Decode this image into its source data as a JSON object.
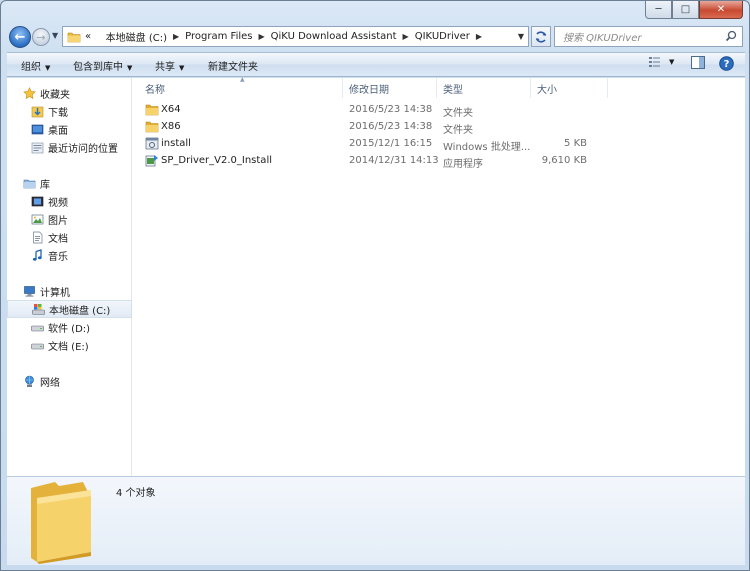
{
  "window": {
    "caption": {
      "minimize": "─",
      "maximize": "□",
      "close": "✕"
    }
  },
  "nav": {
    "back": "←",
    "forward": "→",
    "address_prefix": "«",
    "breadcrumbs": [
      "本地磁盘 (C:)",
      "Program Files",
      "QiKU Download Assistant",
      "QIKUDriver"
    ],
    "search_placeholder": "搜索 QIKUDriver"
  },
  "toolbar": {
    "organize": "组织",
    "include_library": "包含到库中",
    "share": "共享",
    "new_folder": "新建文件夹"
  },
  "sidebar": {
    "favorites": {
      "label": "收藏夹",
      "items": [
        "下载",
        "桌面",
        "最近访问的位置"
      ]
    },
    "libraries": {
      "label": "库",
      "items": [
        "视频",
        "图片",
        "文档",
        "音乐"
      ]
    },
    "computer": {
      "label": "计算机",
      "items": [
        "本地磁盘 (C:)",
        "软件 (D:)",
        "文档 (E:)"
      ]
    },
    "network": {
      "label": "网络"
    }
  },
  "columns": {
    "name": "名称",
    "modified": "修改日期",
    "type": "类型",
    "size": "大小"
  },
  "files": [
    {
      "name": "X64",
      "modified": "2016/5/23 14:38",
      "type": "文件夹",
      "size": "",
      "icon": "folder-icon"
    },
    {
      "name": "X86",
      "modified": "2016/5/23 14:38",
      "type": "文件夹",
      "size": "",
      "icon": "folder-icon"
    },
    {
      "name": "install",
      "modified": "2015/12/1 16:15",
      "type": "Windows 批处理...",
      "size": "5 KB",
      "icon": "batch-file-icon"
    },
    {
      "name": "SP_Driver_V2.0_Install",
      "modified": "2014/12/31 14:13",
      "type": "应用程序",
      "size": "9,610 KB",
      "icon": "application-icon"
    }
  ],
  "details": {
    "count": "4 个对象"
  },
  "colors": {
    "accent": "#2b6fc4",
    "folder": "#f2c94c",
    "selection": "#e2ebf5"
  }
}
